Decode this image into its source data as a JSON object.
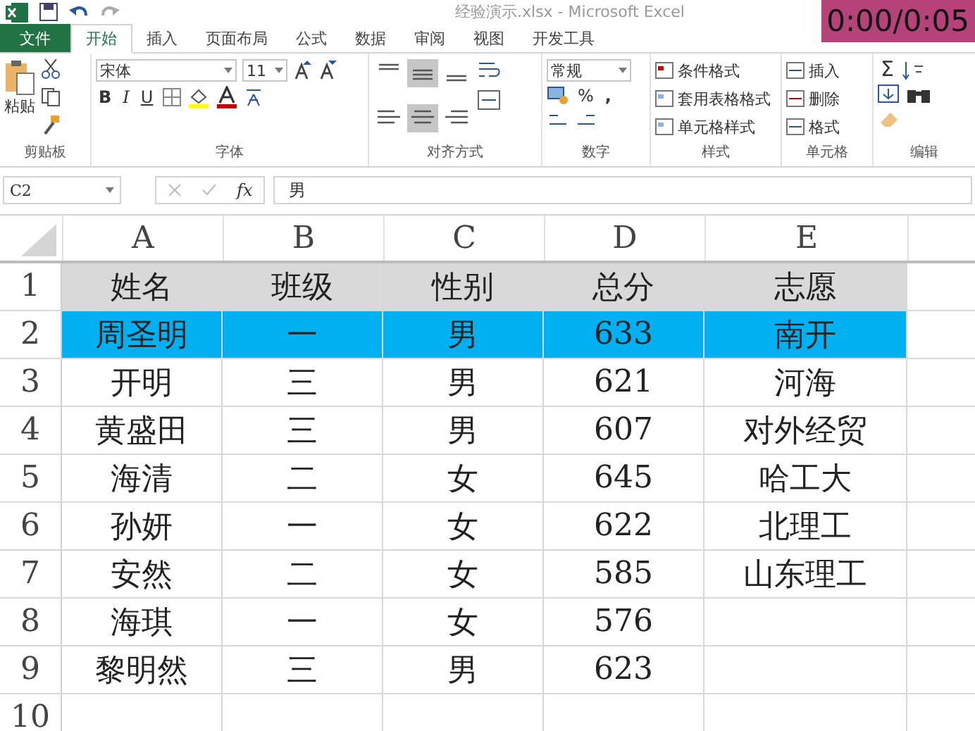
{
  "window": {
    "title": "经验演示.xlsx - Microsoft Excel"
  },
  "tabs": [
    {
      "label": "文件",
      "kind": "file",
      "selected": false
    },
    {
      "label": "开始",
      "kind": "tab",
      "selected": true
    },
    {
      "label": "插入",
      "kind": "tab",
      "selected": false
    },
    {
      "label": "页面布局",
      "kind": "tab",
      "selected": false
    },
    {
      "label": "公式",
      "kind": "tab",
      "selected": false
    },
    {
      "label": "数据",
      "kind": "tab",
      "selected": false
    },
    {
      "label": "审阅",
      "kind": "tab",
      "selected": false
    },
    {
      "label": "视图",
      "kind": "tab",
      "selected": false
    },
    {
      "label": "开发工具",
      "kind": "tab",
      "selected": false
    }
  ],
  "ribbon": {
    "clipboard": {
      "paste": "粘贴",
      "label": "剪贴板"
    },
    "font": {
      "name": "宋体",
      "size": "11",
      "styles": [
        "B",
        "I",
        "U"
      ],
      "label": "字体"
    },
    "alignment": {
      "buttons": [
        {
          "selected": false
        },
        {
          "selected": true
        },
        {
          "selected": false
        },
        {
          "selected": false
        },
        {
          "selected": true
        },
        {
          "selected": false
        }
      ],
      "label": "对齐方式"
    },
    "number": {
      "format": "常规",
      "percent": "%",
      "comma": ",",
      "label": "数字"
    },
    "styles": {
      "items": [
        "条件格式",
        "套用表格格式",
        "单元格样式"
      ],
      "label": "样式"
    },
    "cells": {
      "items": [
        "插入",
        "删除",
        "格式"
      ],
      "label": "单元格"
    },
    "editing": {
      "sum": "Σ",
      "label": "编辑"
    }
  },
  "formula_bar": {
    "name_box": "C2",
    "fx": "fx",
    "value": "男"
  },
  "sheet": {
    "columns": [
      "A",
      "B",
      "C",
      "D",
      "E"
    ],
    "rows": [
      {
        "number": "1",
        "color": "#d9d9d9",
        "cells": [
          "姓名",
          "班级",
          "性别",
          "总分",
          "志愿"
        ]
      },
      {
        "number": "2",
        "color": "#00b0f0",
        "cells": [
          "周圣明",
          "一",
          "男",
          "633",
          "南开"
        ]
      },
      {
        "number": "3",
        "cells": [
          "开明",
          "三",
          "男",
          "621",
          "河海"
        ]
      },
      {
        "number": "4",
        "cells": [
          "黄盛田",
          "三",
          "男",
          "607",
          "对外经贸"
        ]
      },
      {
        "number": "5",
        "cells": [
          "海清",
          "二",
          "女",
          "645",
          "哈工大"
        ]
      },
      {
        "number": "6",
        "cells": [
          "孙妍",
          "一",
          "女",
          "622",
          "北理工"
        ]
      },
      {
        "number": "7",
        "cells": [
          "安然",
          "二",
          "女",
          "585",
          "山东理工"
        ]
      },
      {
        "number": "8",
        "cells": [
          "海琪",
          "一",
          "女",
          "576",
          ""
        ]
      },
      {
        "number": "9",
        "cells": [
          "黎明然",
          "三",
          "男",
          "623",
          ""
        ]
      },
      {
        "number": "10",
        "cells": []
      }
    ]
  },
  "video_timer": "0:00/0:05"
}
